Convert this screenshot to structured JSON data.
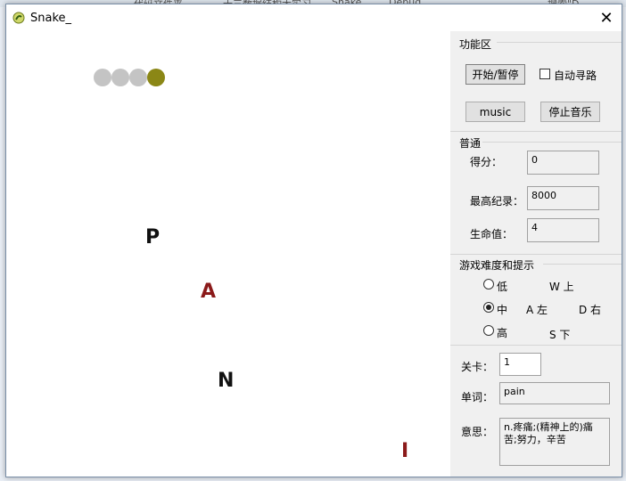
{
  "window": {
    "title": "Snake_"
  },
  "background_strip": [
    "代码文件夹",
    "十三数据结构大实习",
    "Snake",
    "Debug",
    "搜索\"D..."
  ],
  "game": {
    "letters": [
      {
        "char": "P",
        "color": "#111111"
      },
      {
        "char": "A",
        "color": "#8b1a1a"
      },
      {
        "char": "N",
        "color": "#111111"
      },
      {
        "char": "I",
        "color": "#8b1a1a"
      }
    ],
    "snake_colors": {
      "body": "#c4c4c4",
      "head": "#8b8716"
    }
  },
  "panel": {
    "function_group": "功能区",
    "start_pause": "开始/暂停",
    "auto_path": "自动寻路",
    "music": "music",
    "stop_music": "停止音乐",
    "normal_group": "普通",
    "score_label": "得分：",
    "score": "0",
    "high_score_label": "最高纪录：",
    "high_score": "8000",
    "life_label": "生命值：",
    "life": "4",
    "difficulty_group": "游戏难度和提示",
    "difficulty": {
      "low": "低",
      "mid": "中",
      "high": "高",
      "selected": "中"
    },
    "hints": {
      "up": "W 上",
      "left": "A 左",
      "right": "D 右",
      "down": "S 下"
    },
    "level_label": "关卡：",
    "level": "1",
    "word_label": "单词：",
    "word": "pain",
    "meaning_label": "意思：",
    "meaning": "n.疼痛;(精神上的)痛苦;努力，辛苦"
  }
}
